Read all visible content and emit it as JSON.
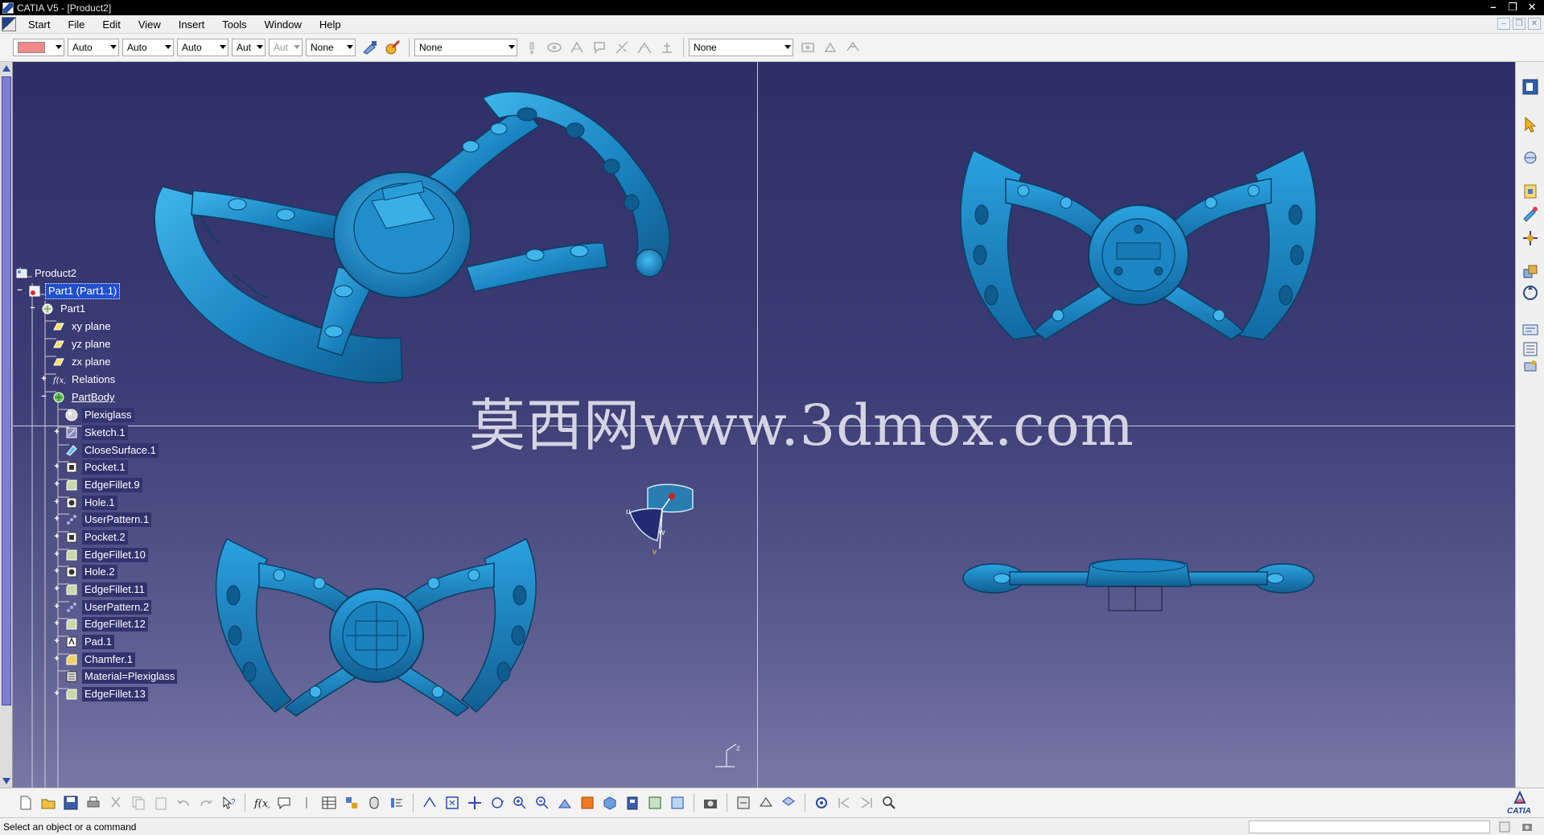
{
  "window": {
    "title": "CATIA V5 - [Product2]"
  },
  "menu": {
    "items": [
      "Start",
      "File",
      "Edit",
      "View",
      "Insert",
      "Tools",
      "Window",
      "Help"
    ]
  },
  "graphic_properties": {
    "color": "#f08a8a",
    "transparency": "Auto",
    "linetype": "Auto",
    "thickness": "Auto",
    "point_symbol": "Aut",
    "rendering": "Aut",
    "layer": "None",
    "style_filter": "None",
    "second_filter": "None"
  },
  "tree": {
    "nodes": [
      {
        "label": "Product2",
        "icon": "product-icon",
        "style": "plain"
      },
      {
        "label": "Part1 (Part1.1)",
        "icon": "part-instance-icon",
        "style": "selected"
      },
      {
        "label": "Part1",
        "icon": "part-icon",
        "style": "plain"
      },
      {
        "label": "xy plane",
        "icon": "plane-icon",
        "style": "plain"
      },
      {
        "label": "yz plane",
        "icon": "plane-icon",
        "style": "plain"
      },
      {
        "label": "zx plane",
        "icon": "plane-icon",
        "style": "plain"
      },
      {
        "label": "Relations",
        "icon": "relations-icon",
        "style": "plain"
      },
      {
        "label": "PartBody",
        "icon": "partbody-icon",
        "style": "underline"
      },
      {
        "label": "Plexiglass",
        "icon": "material-sphere-icon",
        "style": "hl"
      },
      {
        "label": "Sketch.1",
        "icon": "sketch-icon",
        "style": "hl"
      },
      {
        "label": "CloseSurface.1",
        "icon": "close-surface-icon",
        "style": "hl"
      },
      {
        "label": "Pocket.1",
        "icon": "pocket-icon",
        "style": "hl"
      },
      {
        "label": "EdgeFillet.9",
        "icon": "edge-fillet-icon",
        "style": "hl"
      },
      {
        "label": "Hole.1",
        "icon": "hole-icon",
        "style": "hl"
      },
      {
        "label": "UserPattern.1",
        "icon": "user-pattern-icon",
        "style": "hl"
      },
      {
        "label": "Pocket.2",
        "icon": "pocket-icon",
        "style": "hl"
      },
      {
        "label": "EdgeFillet.10",
        "icon": "edge-fillet-icon",
        "style": "hl"
      },
      {
        "label": "Hole.2",
        "icon": "hole-icon",
        "style": "hl"
      },
      {
        "label": "EdgeFillet.11",
        "icon": "edge-fillet-icon",
        "style": "hl"
      },
      {
        "label": "UserPattern.2",
        "icon": "user-pattern-icon",
        "style": "hl"
      },
      {
        "label": "EdgeFillet.12",
        "icon": "edge-fillet-icon",
        "style": "hl"
      },
      {
        "label": "Pad.1",
        "icon": "pad-icon",
        "style": "hl"
      },
      {
        "label": "Chamfer.1",
        "icon": "chamfer-icon",
        "style": "hl"
      },
      {
        "label": "Material=Plexiglass",
        "icon": "material-icon",
        "style": "hl"
      },
      {
        "label": "EdgeFillet.13",
        "icon": "edge-fillet-icon",
        "style": "hl"
      }
    ]
  },
  "watermark": "莫西网www.3dmox.com",
  "compass": {
    "axis_u": "u",
    "axis_v": "v",
    "axis_w": "w"
  },
  "axis_mini": {
    "label": "z"
  },
  "status": {
    "message": "Select an object or a command"
  },
  "logo": {
    "text": "CATIA"
  },
  "colors": {
    "viewport_top": "#2e2f66",
    "viewport_bottom": "#7878a6",
    "part": "#1e8fc8",
    "selection": "#1f4fcf"
  }
}
